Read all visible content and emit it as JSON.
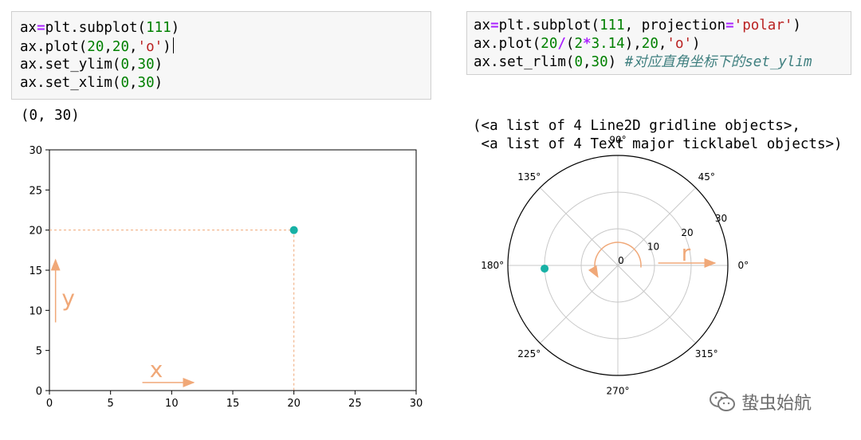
{
  "left_cell": {
    "lines": [
      [
        {
          "t": "ax",
          "c": "var"
        },
        {
          "t": "=",
          "c": "op"
        },
        {
          "t": "plt.subplot(",
          "c": "var"
        },
        {
          "t": "111",
          "c": "num"
        },
        {
          "t": ")",
          "c": "var"
        }
      ],
      [
        {
          "t": "ax.plot(",
          "c": "var"
        },
        {
          "t": "20",
          "c": "num"
        },
        {
          "t": ",",
          "c": "var"
        },
        {
          "t": "20",
          "c": "num"
        },
        {
          "t": ",",
          "c": "var"
        },
        {
          "t": "'o'",
          "c": "str"
        },
        {
          "t": ")",
          "c": "var"
        }
      ],
      [
        {
          "t": "ax.set_ylim(",
          "c": "var"
        },
        {
          "t": "0",
          "c": "num"
        },
        {
          "t": ",",
          "c": "var"
        },
        {
          "t": "30",
          "c": "num"
        },
        {
          "t": ")",
          "c": "var"
        }
      ],
      [
        {
          "t": "ax.set_xlim(",
          "c": "var"
        },
        {
          "t": "0",
          "c": "num"
        },
        {
          "t": ",",
          "c": "var"
        },
        {
          "t": "30",
          "c": "num"
        },
        {
          "t": ")",
          "c": "var"
        }
      ]
    ],
    "output": "(0, 30)"
  },
  "right_cell": {
    "lines": [
      [
        {
          "t": "ax",
          "c": "var"
        },
        {
          "t": "=",
          "c": "op"
        },
        {
          "t": "plt.subplot(",
          "c": "var"
        },
        {
          "t": "111",
          "c": "num"
        },
        {
          "t": ", projection",
          "c": "var"
        },
        {
          "t": "=",
          "c": "op"
        },
        {
          "t": "'polar'",
          "c": "str"
        },
        {
          "t": ")",
          "c": "var"
        }
      ],
      [
        {
          "t": "ax.plot(",
          "c": "var"
        },
        {
          "t": "20",
          "c": "num"
        },
        {
          "t": "/",
          "c": "op"
        },
        {
          "t": "(",
          "c": "var"
        },
        {
          "t": "2",
          "c": "num"
        },
        {
          "t": "*",
          "c": "op"
        },
        {
          "t": "3.14",
          "c": "num"
        },
        {
          "t": "),",
          "c": "var"
        },
        {
          "t": "20",
          "c": "num"
        },
        {
          "t": ",",
          "c": "var"
        },
        {
          "t": "'o'",
          "c": "str"
        },
        {
          "t": ")",
          "c": "var"
        }
      ],
      [
        {
          "t": "ax.set_rlim(",
          "c": "var"
        },
        {
          "t": "0",
          "c": "num"
        },
        {
          "t": ",",
          "c": "var"
        },
        {
          "t": "30",
          "c": "num"
        },
        {
          "t": ") ",
          "c": "var"
        },
        {
          "t": "#对应直角坐标下的set_ylim",
          "c": "comment"
        }
      ]
    ],
    "output": [
      "(<a list of 4 Line2D gridline objects>,",
      " <a list of 4 Text major ticklabel objects>)"
    ]
  },
  "chart_data": [
    {
      "type": "scatter",
      "title": "",
      "xlabel": "",
      "ylabel": "",
      "xlim": [
        0,
        30
      ],
      "ylim": [
        0,
        30
      ],
      "x_ticks": [
        "0",
        "5",
        "10",
        "15",
        "20",
        "25",
        "30"
      ],
      "y_ticks": [
        "0",
        "5",
        "10",
        "15",
        "20",
        "25",
        "30"
      ],
      "points": [
        {
          "x": 20,
          "y": 20
        }
      ],
      "annotations": {
        "x_arrow_label": "x",
        "y_arrow_label": "y"
      },
      "grid": false,
      "marker_color": "#17b1a5",
      "annotation_color": "#f0a878"
    },
    {
      "type": "scatter",
      "projection": "polar",
      "title": "",
      "rlim": [
        0,
        30
      ],
      "r_ticks": [
        "0",
        "10",
        "20",
        "30"
      ],
      "theta_ticks": [
        "0°",
        "45°",
        "90°",
        "135°",
        "180°",
        "225°",
        "270°",
        "315°"
      ],
      "points": [
        {
          "theta_rad": 3.1847,
          "r": 20
        }
      ],
      "annotations": {
        "r_arrow_label": "r"
      },
      "grid": true,
      "marker_color": "#17b1a5",
      "annotation_color": "#f0a878"
    }
  ],
  "watermark": {
    "text": "蛰虫始航",
    "icon": "wechat-icon"
  }
}
